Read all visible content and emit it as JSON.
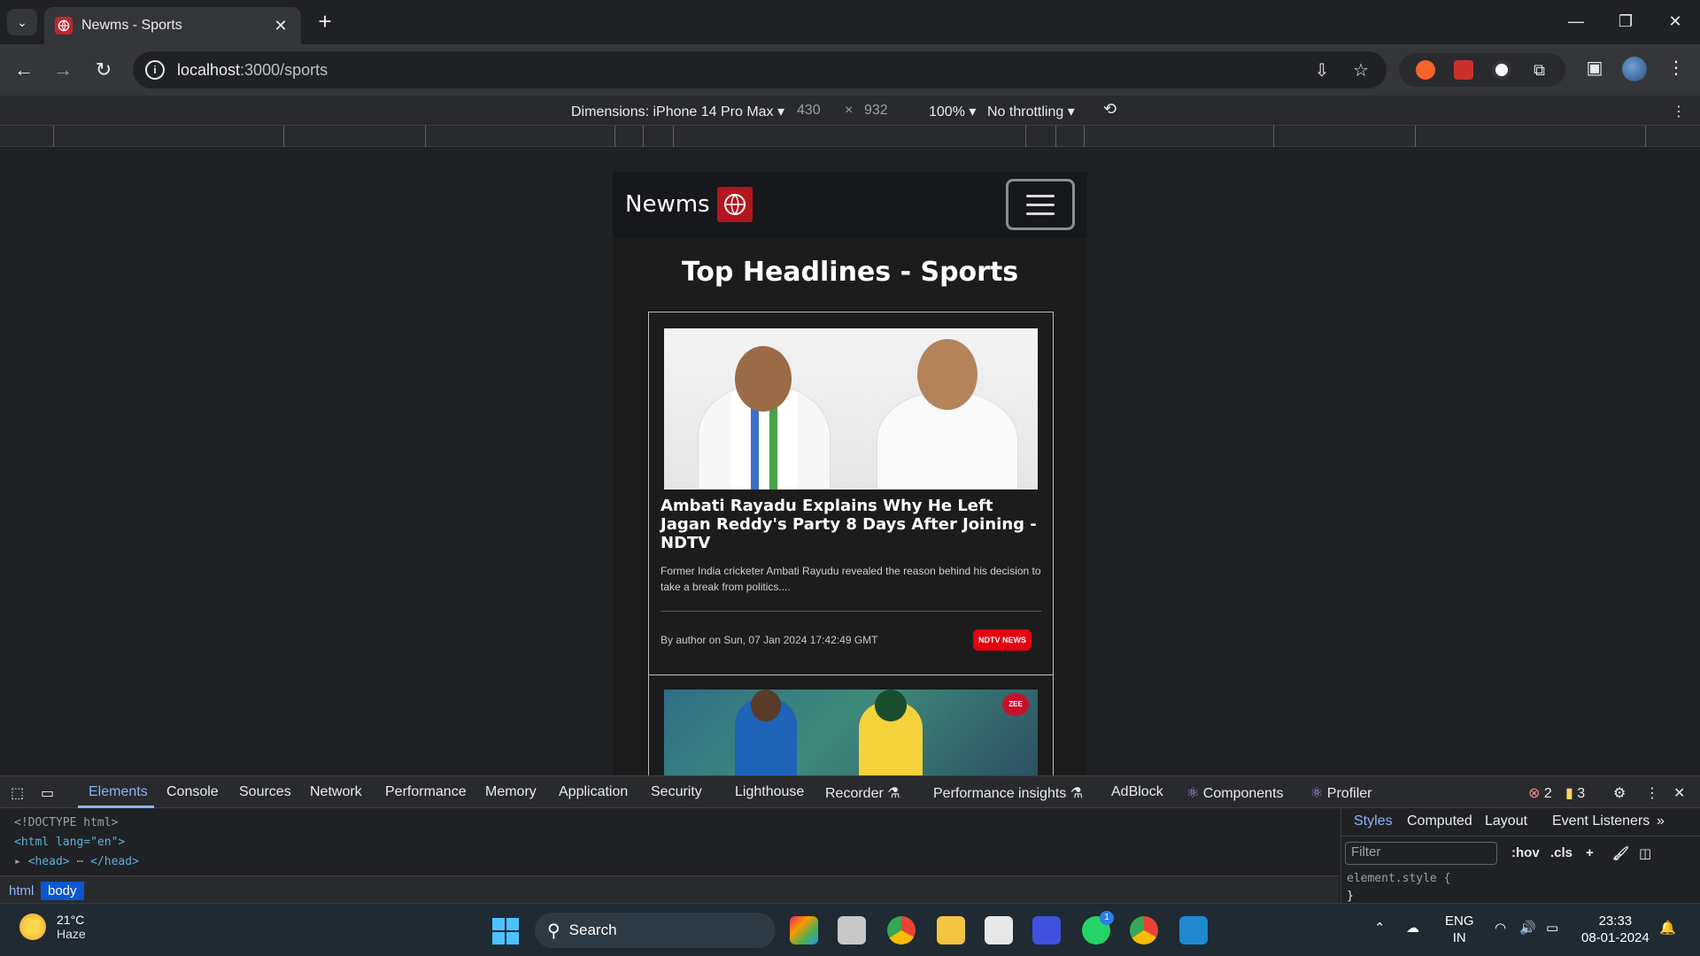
{
  "browser": {
    "tab_title": "Newms - Sports",
    "url_host": "localhost",
    "url_path": ":3000/sports",
    "window_controls": [
      "—",
      "❐",
      "✕"
    ]
  },
  "device_toolbar": {
    "dimensions_label": "Dimensions: iPhone 14 Pro Max",
    "width": "430",
    "times": "×",
    "height": "932",
    "zoom": "100%",
    "throttling": "No throttling"
  },
  "app": {
    "brand": "Newms",
    "page_heading": "Top Headlines - Sports",
    "articles": [
      {
        "title": "Ambati Rayadu Explains Why He Left Jagan Reddy's Party 8 Days After Joining - NDTV",
        "description": "Former India cricketer Ambati Rayudu revealed the reason behind his decision to take a break from politics....",
        "byline": "By author on Sun, 07 Jan 2024 17:42:49 GMT",
        "source": "NDTV NEWS"
      },
      {
        "image_logo": "ZEE"
      }
    ]
  },
  "devtools": {
    "tabs": [
      "Elements",
      "Console",
      "Sources",
      "Network",
      "Performance",
      "Memory",
      "Application",
      "Security",
      "Lighthouse",
      "Recorder",
      "Performance insights",
      "AdBlock",
      "Components",
      "Profiler"
    ],
    "errors": "2",
    "warnings": "3",
    "dom_lines": [
      "<!DOCTYPE html>",
      "<html lang=\"en\">",
      "<head>",
      "</head>"
    ],
    "breadcrumbs": [
      "html",
      "body"
    ],
    "styles_tabs": [
      "Styles",
      "Computed",
      "Layout",
      "Event Listeners"
    ],
    "filter_placeholder": "Filter",
    "hov": ":hov",
    "cls": ".cls",
    "element_style": "element.style {",
    "close_brace": "}"
  },
  "taskbar": {
    "temperature": "21°C",
    "weather": "Haze",
    "search": "Search",
    "lang1": "ENG",
    "lang2": "IN",
    "time": "23:33",
    "date": "08-01-2024",
    "whatsapp_badge": "1"
  }
}
